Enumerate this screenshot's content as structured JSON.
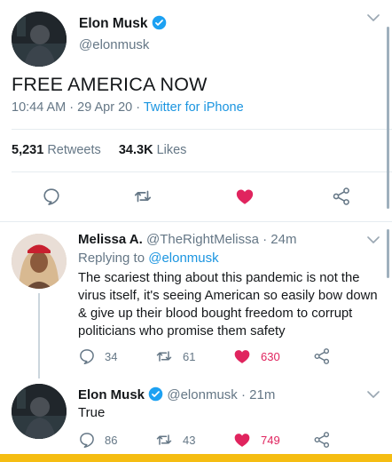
{
  "main_tweet": {
    "author_name": "Elon Musk",
    "author_handle": "@elonmusk",
    "text": "FREE AMERICA NOW",
    "time": "10:44 AM",
    "date": "29 Apr 20",
    "source": "Twitter for iPhone",
    "retweets_count": "5,231",
    "retweets_label": "Retweets",
    "likes_count": "34.3K",
    "likes_label": "Likes"
  },
  "reply1": {
    "author_name": "Melissa A.",
    "author_handle": "@TheRightMelissa",
    "age": "24m",
    "replying_label": "Replying to",
    "replying_to": "@elonmusk",
    "text": "The scariest thing about this pandemic is not the virus itself, it's seeing American so easily bow down & give up their blood bought freedom to corrupt politicians who promise them safety",
    "replies": "34",
    "retweets": "61",
    "likes": "630"
  },
  "reply2": {
    "author_name": "Elon Musk",
    "author_handle": "@elonmusk",
    "age": "21m",
    "text": "True",
    "replies": "86",
    "retweets": "43",
    "likes": "749"
  },
  "colors": {
    "accent": "#1da1f2",
    "like": "#e0245e",
    "muted": "#657786",
    "bottom_bar": "#f5bd12"
  }
}
